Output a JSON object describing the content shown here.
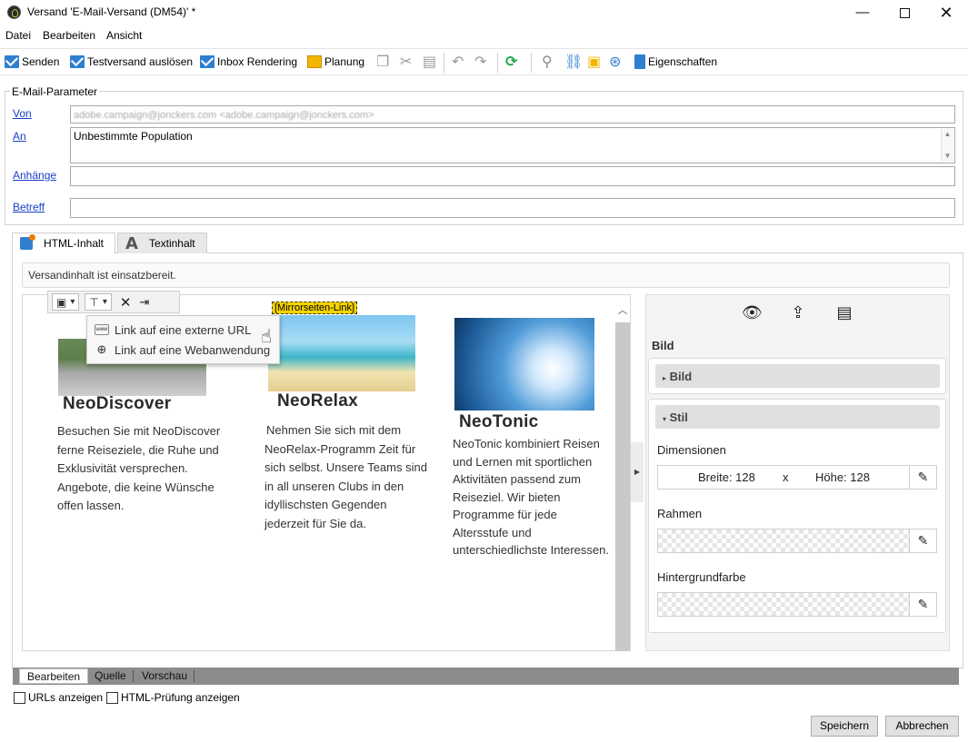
{
  "window": {
    "title": "Versand 'E-Mail-Versand (DM54)' *",
    "minimize": "—",
    "close": "✕"
  },
  "menu": [
    "Datei",
    "Bearbeiten",
    "Ansicht"
  ],
  "toolbar": {
    "send": "Senden",
    "test_send": "Testversand auslösen",
    "inbox_rendering": "Inbox Rendering",
    "planning": "Planung",
    "properties": "Eigenschaften"
  },
  "email_params": {
    "group_label": "E-Mail-Parameter",
    "from_label": "Von",
    "from_value": "adobe.campaign@jonckers.com <adobe.campaign@jonckers.com>",
    "to_label": "An",
    "to_value": "Unbestimmte Population",
    "attachments_label": "Anhänge",
    "attachments_value": "",
    "subject_label": "Betreff",
    "subject_value": ""
  },
  "tabs": {
    "html": "HTML-Inhalt",
    "text": "Textinhalt"
  },
  "status_message": "Versandinhalt ist einsatzbereit.",
  "editor": {
    "mirror_link": "[Mirrorseiten-Link]",
    "dropdown": [
      {
        "label": "Link auf eine externe URL",
        "icon": "www-link-icon",
        "icon_text": "www"
      },
      {
        "label": "Link auf eine Webanwendung",
        "icon": "globe-link-icon"
      }
    ],
    "articles": [
      {
        "title": "NeoDiscover",
        "lines": [
          "Besuchen Sie mit NeoDiscover",
          "ferne Reiseziele, die Ruhe und",
          "Exklusivität versprechen.",
          "Angebote, die keine Wünsche",
          "offen lassen."
        ]
      },
      {
        "title": "NeoRelax",
        "lines": [
          "Nehmen Sie sich mit dem",
          "NeoRelax-Programm Zeit für",
          "sich selbst. Unsere Teams sind",
          "in all unseren Clubs in den",
          "idyllischsten Gegenden",
          "jederzeit für Sie da."
        ]
      },
      {
        "title": "NeoTonic",
        "lines": [
          "NeoTonic kombiniert Reisen",
          "und Lernen mit sportlichen",
          "Aktivitäten passend zum",
          "Reiseziel. Wir bieten",
          "Programme für jede",
          "Altersstufe und",
          "unterschiedlichste Interessen."
        ]
      }
    ]
  },
  "properties_panel": {
    "heading": "Bild",
    "section_image": "Bild",
    "section_style": "Stil",
    "dimensions_label": "Dimensionen",
    "width_text": "Breite: 128",
    "x_text": "x",
    "height_text": "Höhe: 128",
    "border_label": "Rahmen",
    "background_label": "Hintergrundfarbe"
  },
  "view_tabs": [
    "Bearbeiten",
    "Quelle",
    "Vorschau"
  ],
  "checkboxes": {
    "show_urls": "URLs anzeigen",
    "show_html_check": "HTML-Prüfung anzeigen"
  },
  "buttons": {
    "save": "Speichern",
    "cancel": "Abbrechen"
  },
  "colors": {
    "link": "#1a3fc8",
    "mirror_highlight": "#f5d400",
    "accent_blue": "#2f7fd0"
  }
}
